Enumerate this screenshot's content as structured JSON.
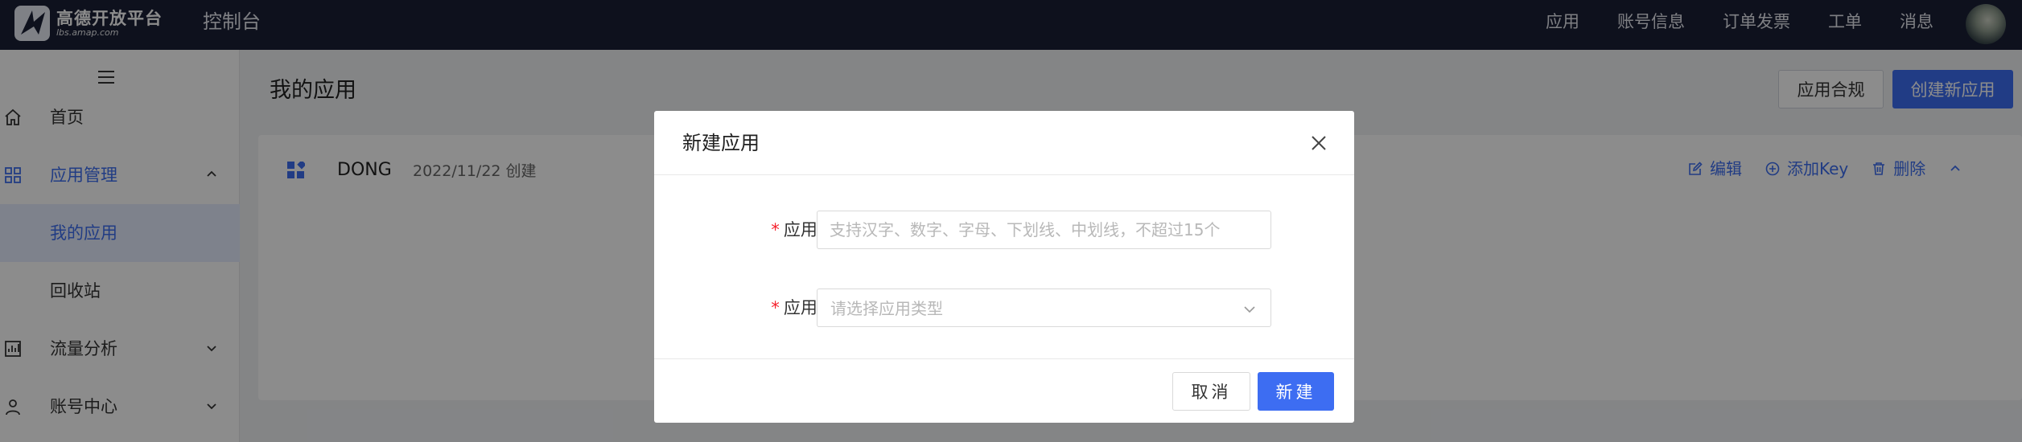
{
  "topbar": {
    "logo_cn": "高德开放平台",
    "logo_en": "lbs.amap.com",
    "console": "控制台",
    "nav": [
      "应用",
      "账号信息",
      "订单发票",
      "工单",
      "消息"
    ]
  },
  "sidebar": {
    "items": [
      {
        "label": "首页",
        "icon": "home-icon"
      },
      {
        "label": "应用管理",
        "icon": "apps-icon",
        "expanded": true
      },
      {
        "label": "我的应用",
        "active": true
      },
      {
        "label": "回收站"
      },
      {
        "label": "流量分析",
        "icon": "chart-icon"
      },
      {
        "label": "账号中心",
        "icon": "user-icon"
      }
    ]
  },
  "main": {
    "title": "我的应用",
    "compliance_btn": "应用合规",
    "create_btn": "创建新应用",
    "app": {
      "name": "DONG",
      "created": "2022/11/22 创建",
      "actions": {
        "edit": "编辑",
        "add_key": "添加Key",
        "delete": "删除"
      }
    }
  },
  "modal": {
    "title": "新建应用",
    "name_label": "应用名称:",
    "name_placeholder": "支持汉字、数字、字母、下划线、中划线，不超过15个",
    "type_label": "应用类型:",
    "type_placeholder": "请选择应用类型",
    "cancel": "取消",
    "create": "新建"
  },
  "colors": {
    "topbar": "#1a1f36",
    "primary": "#3d6df2",
    "required": "#f5222d"
  }
}
